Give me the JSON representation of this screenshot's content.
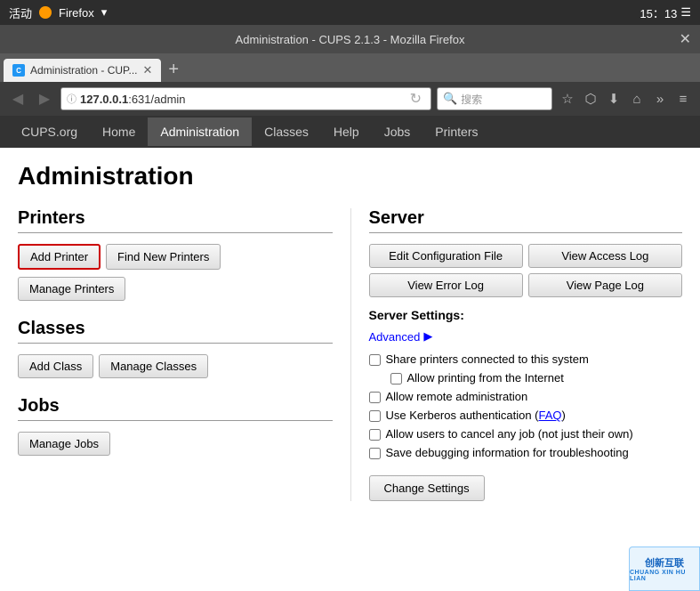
{
  "os_bar": {
    "left": "活动",
    "browser_label": "Firefox",
    "time": "15：13"
  },
  "browser": {
    "title": "Administration - CUPS 2.1.3 - Mozilla Firefox",
    "close_sym": "✕",
    "tab_label": "Administration - CUP...",
    "tab_favicon": "C",
    "new_tab_sym": "+",
    "url": "127.0.0.1:631/admin",
    "url_icon": "ⓘ",
    "url_host_part": "127.0.0.1",
    "url_path": ":631/admin",
    "search_placeholder": "搜索",
    "refresh_sym": "↻",
    "back_sym": "◀",
    "forward_sym": "▶",
    "bookmark_sym": "☆",
    "download_sym": "⬇",
    "home_sym": "⌂",
    "more_sym": "»",
    "menu_sym": "≡"
  },
  "cups_nav": {
    "items": [
      {
        "label": "CUPS.org",
        "active": false
      },
      {
        "label": "Home",
        "active": false
      },
      {
        "label": "Administration",
        "active": true
      },
      {
        "label": "Classes",
        "active": false
      },
      {
        "label": "Help",
        "active": false
      },
      {
        "label": "Jobs",
        "active": false
      },
      {
        "label": "Printers",
        "active": false
      }
    ]
  },
  "page": {
    "title": "Administration",
    "printers_section": {
      "heading": "Printers",
      "add_printer": "Add Printer",
      "find_new_printers": "Find New Printers",
      "manage_printers": "Manage Printers"
    },
    "classes_section": {
      "heading": "Classes",
      "add_class": "Add Class",
      "manage_classes": "Manage Classes"
    },
    "jobs_section": {
      "heading": "Jobs",
      "manage_jobs": "Manage Jobs"
    },
    "server_section": {
      "heading": "Server",
      "edit_config": "Edit Configuration File",
      "view_access_log": "View Access Log",
      "view_error_log": "View Error Log",
      "view_page_log": "View Page Log",
      "settings_label": "Server Settings:",
      "advanced_label": "Advanced",
      "advanced_arrow": "▶",
      "checkboxes": [
        {
          "id": "cb1",
          "label": "Share printers connected to this system",
          "checked": false,
          "indented": false
        },
        {
          "id": "cb2",
          "label": "Allow printing from the Internet",
          "checked": false,
          "indented": true
        },
        {
          "id": "cb3",
          "label": "Allow remote administration",
          "checked": false,
          "indented": false
        },
        {
          "id": "cb4",
          "label": "Use Kerberos authentication (",
          "link_text": "FAQ",
          "after_link": ")",
          "checked": false,
          "indented": false
        },
        {
          "id": "cb5",
          "label": "Allow users to cancel any job (not just their own)",
          "checked": false,
          "indented": false
        },
        {
          "id": "cb6",
          "label": "Save debugging information for troubleshooting",
          "checked": false,
          "indented": false
        }
      ],
      "change_settings_btn": "Change Settings"
    }
  },
  "watermark": {
    "line1": "创新互联",
    "line2": "CHUANG XIN HU LIAN"
  }
}
